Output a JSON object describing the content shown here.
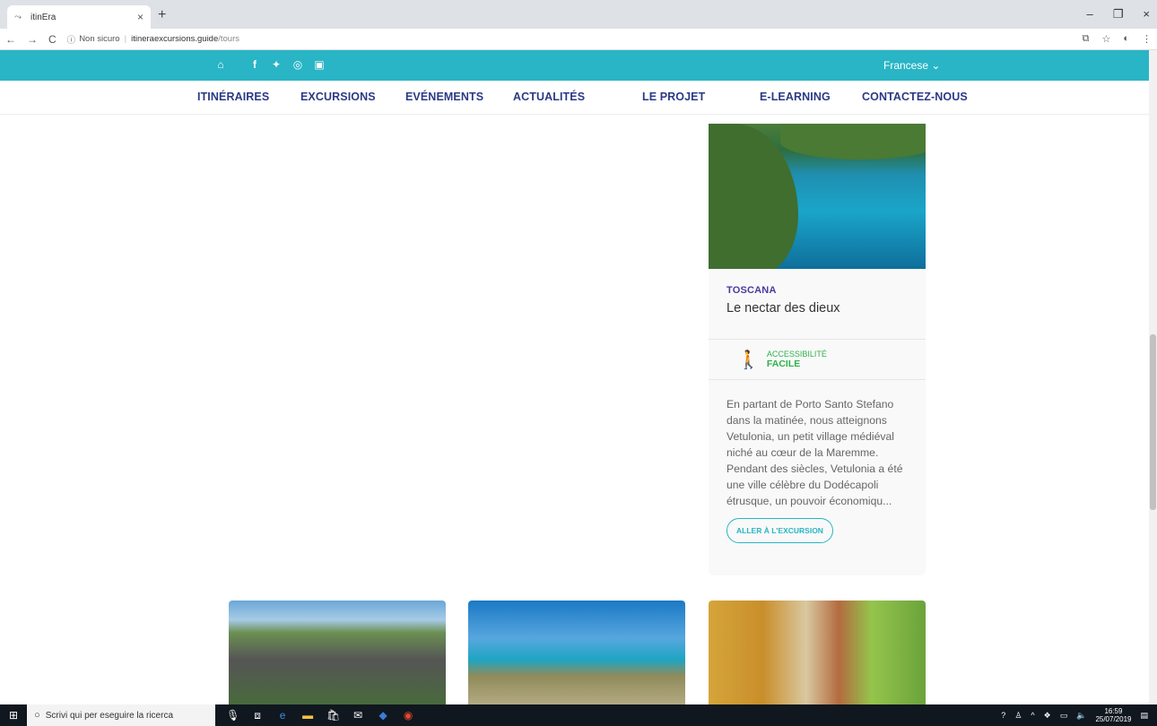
{
  "browser": {
    "tab_title": "itinEra",
    "tab_close": "×",
    "new_tab": "+",
    "back": "←",
    "forward": "→",
    "reload": "C",
    "info_icon": "ⓘ",
    "not_secure": "Non sicuro",
    "url_host": "itineraexcursions.guide",
    "url_path": "/tours",
    "window": {
      "minimize": "–",
      "restore": "❐",
      "close": "×"
    }
  },
  "site": {
    "language": "Francese ⌄",
    "nav": [
      "ITINÉRAIRES",
      "EXCURSIONS",
      "EVÉNEMENTS",
      "ACTUALITÉS",
      "LE PROJET",
      "E-LEARNING",
      "CONTACTEZ-NOUS"
    ]
  },
  "card": {
    "region": "TOSCANA",
    "title": "Le nectar des dieux",
    "access_label": "ACCESSIBILITÉ",
    "access_level": "FACILE",
    "description": "En partant de Porto Santo Stefano dans la matinée, nous atteignons Vetulonia, un petit village médiéval niché au cœur de la Maremme. Pendant des siècles, Vetulonia a été une ville célèbre du Dodécapoli étrusque, un pouvoir économiqu...",
    "cta": "ALLER À L'EXCURSION"
  },
  "taskbar": {
    "search_placeholder": "Scrivi qui per eseguire la ricerca",
    "time": "16:59",
    "date": "25/07/2019"
  }
}
